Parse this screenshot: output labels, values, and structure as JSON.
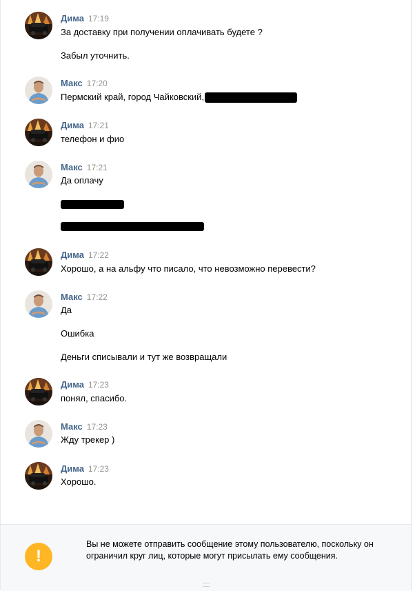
{
  "messages": [
    {
      "author": "Дима",
      "time": "17:19",
      "avatar": "dima-avatar",
      "lines": [
        "За доставку при получении оплачивать будете ?",
        "Забыл уточнить."
      ]
    },
    {
      "author": "Макс",
      "time": "17:20",
      "avatar": "maks-avatar",
      "lines": [
        "Пермский край, город Чайковский,"
      ]
    },
    {
      "author": "Дима",
      "time": "17:21",
      "avatar": "dima-avatar",
      "lines": [
        "телефон и фио"
      ]
    },
    {
      "author": "Макс",
      "time": "17:21",
      "avatar": "maks-avatar",
      "lines": [
        "Да оплачу"
      ]
    },
    {
      "author": "Дима",
      "time": "17:22",
      "avatar": "dima-avatar",
      "lines": [
        "Хорошо, а на альфу что писало, что невозможно перевести?"
      ]
    },
    {
      "author": "Макс",
      "time": "17:22",
      "avatar": "maks-avatar",
      "lines": [
        "Да",
        "Ошибка",
        "Деньги списывали и тут же возвращали"
      ]
    },
    {
      "author": "Дима",
      "time": "17:23",
      "avatar": "dima-avatar",
      "lines": [
        "понял, спасибо."
      ]
    },
    {
      "author": "Макс",
      "time": "17:23",
      "avatar": "maks-avatar",
      "lines": [
        "Жду трекер )"
      ]
    },
    {
      "author": "Дима",
      "time": "17:23",
      "avatar": "dima-avatar",
      "lines": [
        "Хорошо."
      ]
    }
  ],
  "notice": {
    "icon": "exclamation-icon",
    "icon_glyph": "!",
    "text": "Вы не можете отправить сообщение этому пользователю, поскольку он ограничил круг лиц, которые могут присылать ему сообщения."
  },
  "colors": {
    "author": "#42648b",
    "time": "#939393",
    "warning": "#ffb624",
    "notice_bg": "#f7f8fa"
  }
}
